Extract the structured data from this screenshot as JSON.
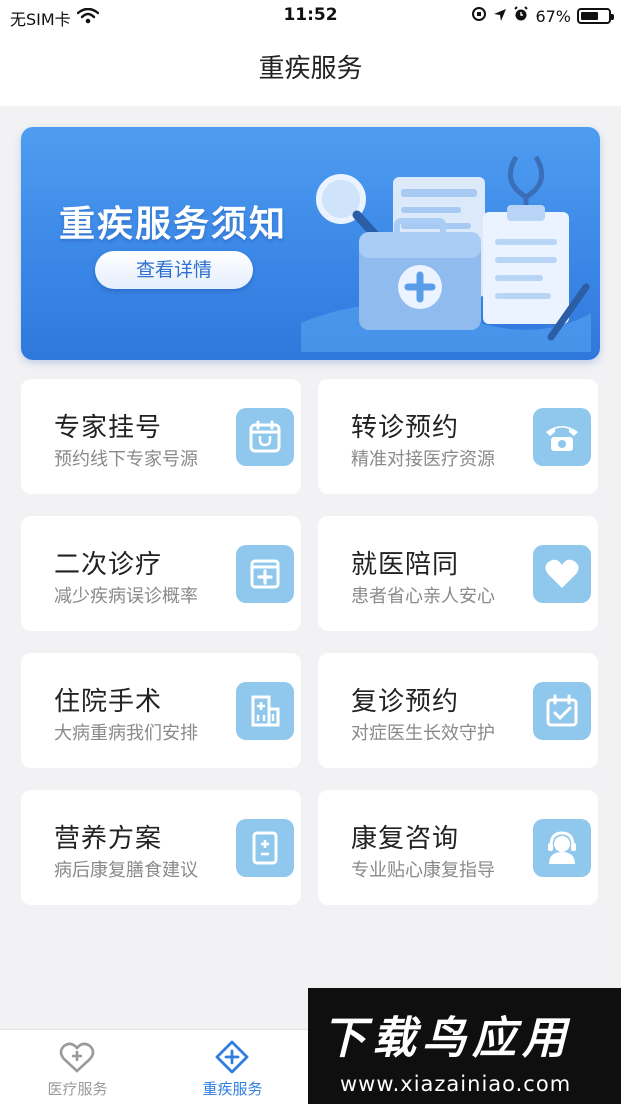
{
  "status_bar": {
    "carrier": "无SIM卡",
    "time": "11:52",
    "battery_percent": "67%",
    "battery_level": 0.67
  },
  "nav": {
    "title": "重疾服务"
  },
  "banner": {
    "title": "重疾服务须知",
    "button_label": "查看详情"
  },
  "services": [
    {
      "title": "专家挂号",
      "subtitle": "预约线下专家号源",
      "icon": "calendar-stethoscope-icon"
    },
    {
      "title": "转诊预约",
      "subtitle": "精准对接医疗资源",
      "icon": "telephone-icon"
    },
    {
      "title": "二次诊疗",
      "subtitle": "减少疾病误诊概率",
      "icon": "medical-box-icon"
    },
    {
      "title": "就医陪同",
      "subtitle": "患者省心亲人安心",
      "icon": "heart-icon"
    },
    {
      "title": "住院手术",
      "subtitle": "大病重病我们安排",
      "icon": "hospital-icon"
    },
    {
      "title": "复诊预约",
      "subtitle": "对症医生长效守护",
      "icon": "calendar-check-icon"
    },
    {
      "title": "营养方案",
      "subtitle": "病后康复膳食建议",
      "icon": "document-plus-minus-icon"
    },
    {
      "title": "康复咨询",
      "subtitle": "专业贴心康复指导",
      "icon": "headset-agent-icon"
    }
  ],
  "tab_bar": {
    "tabs": [
      {
        "label": "医疗服务",
        "active": false,
        "icon": "heart-plus-icon"
      },
      {
        "label": "重疾服务",
        "active": true,
        "icon": "diamond-plus-icon"
      }
    ]
  },
  "watermark": {
    "title": "下载鸟应用",
    "url": "www.xiazainiao.com"
  },
  "colors": {
    "accent": "#2f7ee0",
    "icon_bg": "#8fc8ec",
    "inactive_tab": "#9a9a9a"
  }
}
